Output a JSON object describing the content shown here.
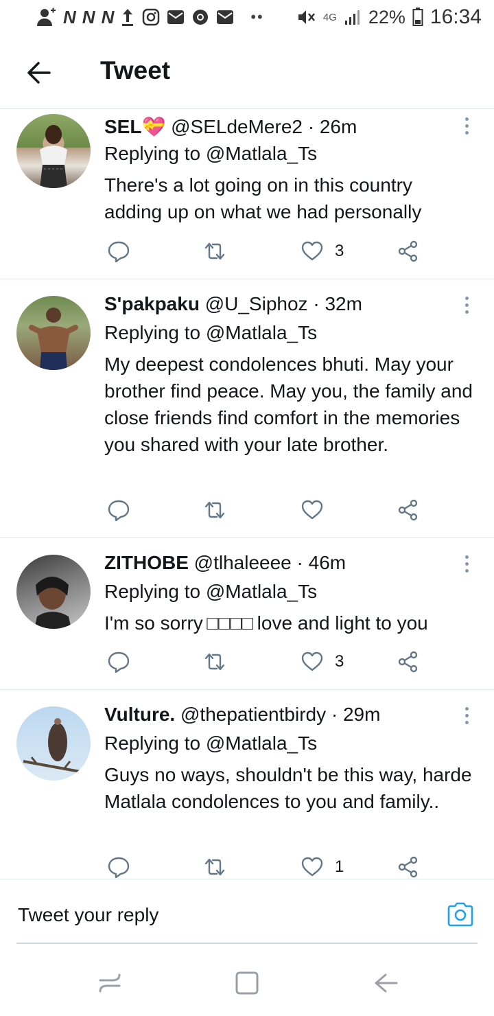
{
  "status_bar": {
    "network_letters": [
      "N",
      "N",
      "N"
    ],
    "network_type": "4G",
    "battery": "22%",
    "time": "16:34",
    "icons": [
      "add-contact-icon",
      "upload-icon",
      "instagram-icon",
      "mail-icon",
      "chrome-icon",
      "mail-icon",
      "more-dots-icon",
      "mute-icon",
      "signal-icon",
      "battery-icon"
    ]
  },
  "header": {
    "title": "Tweet"
  },
  "tweets": [
    {
      "name": "SEL💝",
      "handle": "@SELdeMere2",
      "time": "· 26m",
      "replying_to": "Replying to @Matlala_Ts",
      "text": "There's a lot going on in this  country adding up on what we had personally",
      "likes": "3"
    },
    {
      "name": "S'pakpaku",
      "handle": "@U_Siphoz",
      "time": "· 32m",
      "replying_to": "Replying to @Matlala_Ts",
      "text": "My deepest condolences bhuti. May your brother find peace. May you, the family and close friends find comfort in the memories you shared with your late brother.",
      "likes": ""
    },
    {
      "name": "ZITHOBE",
      "handle": "@tlhaleeee",
      "time": "· 46m",
      "replying_to": "Replying to @Matlala_Ts",
      "text": "I'm so sorry □□□□ love and light to you",
      "likes": "3"
    },
    {
      "name": "Vulture.",
      "handle": "@thepatientbirdy",
      "time": "· 29m",
      "replying_to": "Replying to @Matlala_Ts",
      "text": "Guys no ways, shouldn't be this way, harde Matlala condolences to you and family..",
      "likes": "1"
    }
  ],
  "reply_box": {
    "placeholder": "Tweet your reply"
  },
  "colors": {
    "icon_gray": "#657786",
    "accent": "#1da1f2",
    "divider": "#e1e8ed"
  }
}
